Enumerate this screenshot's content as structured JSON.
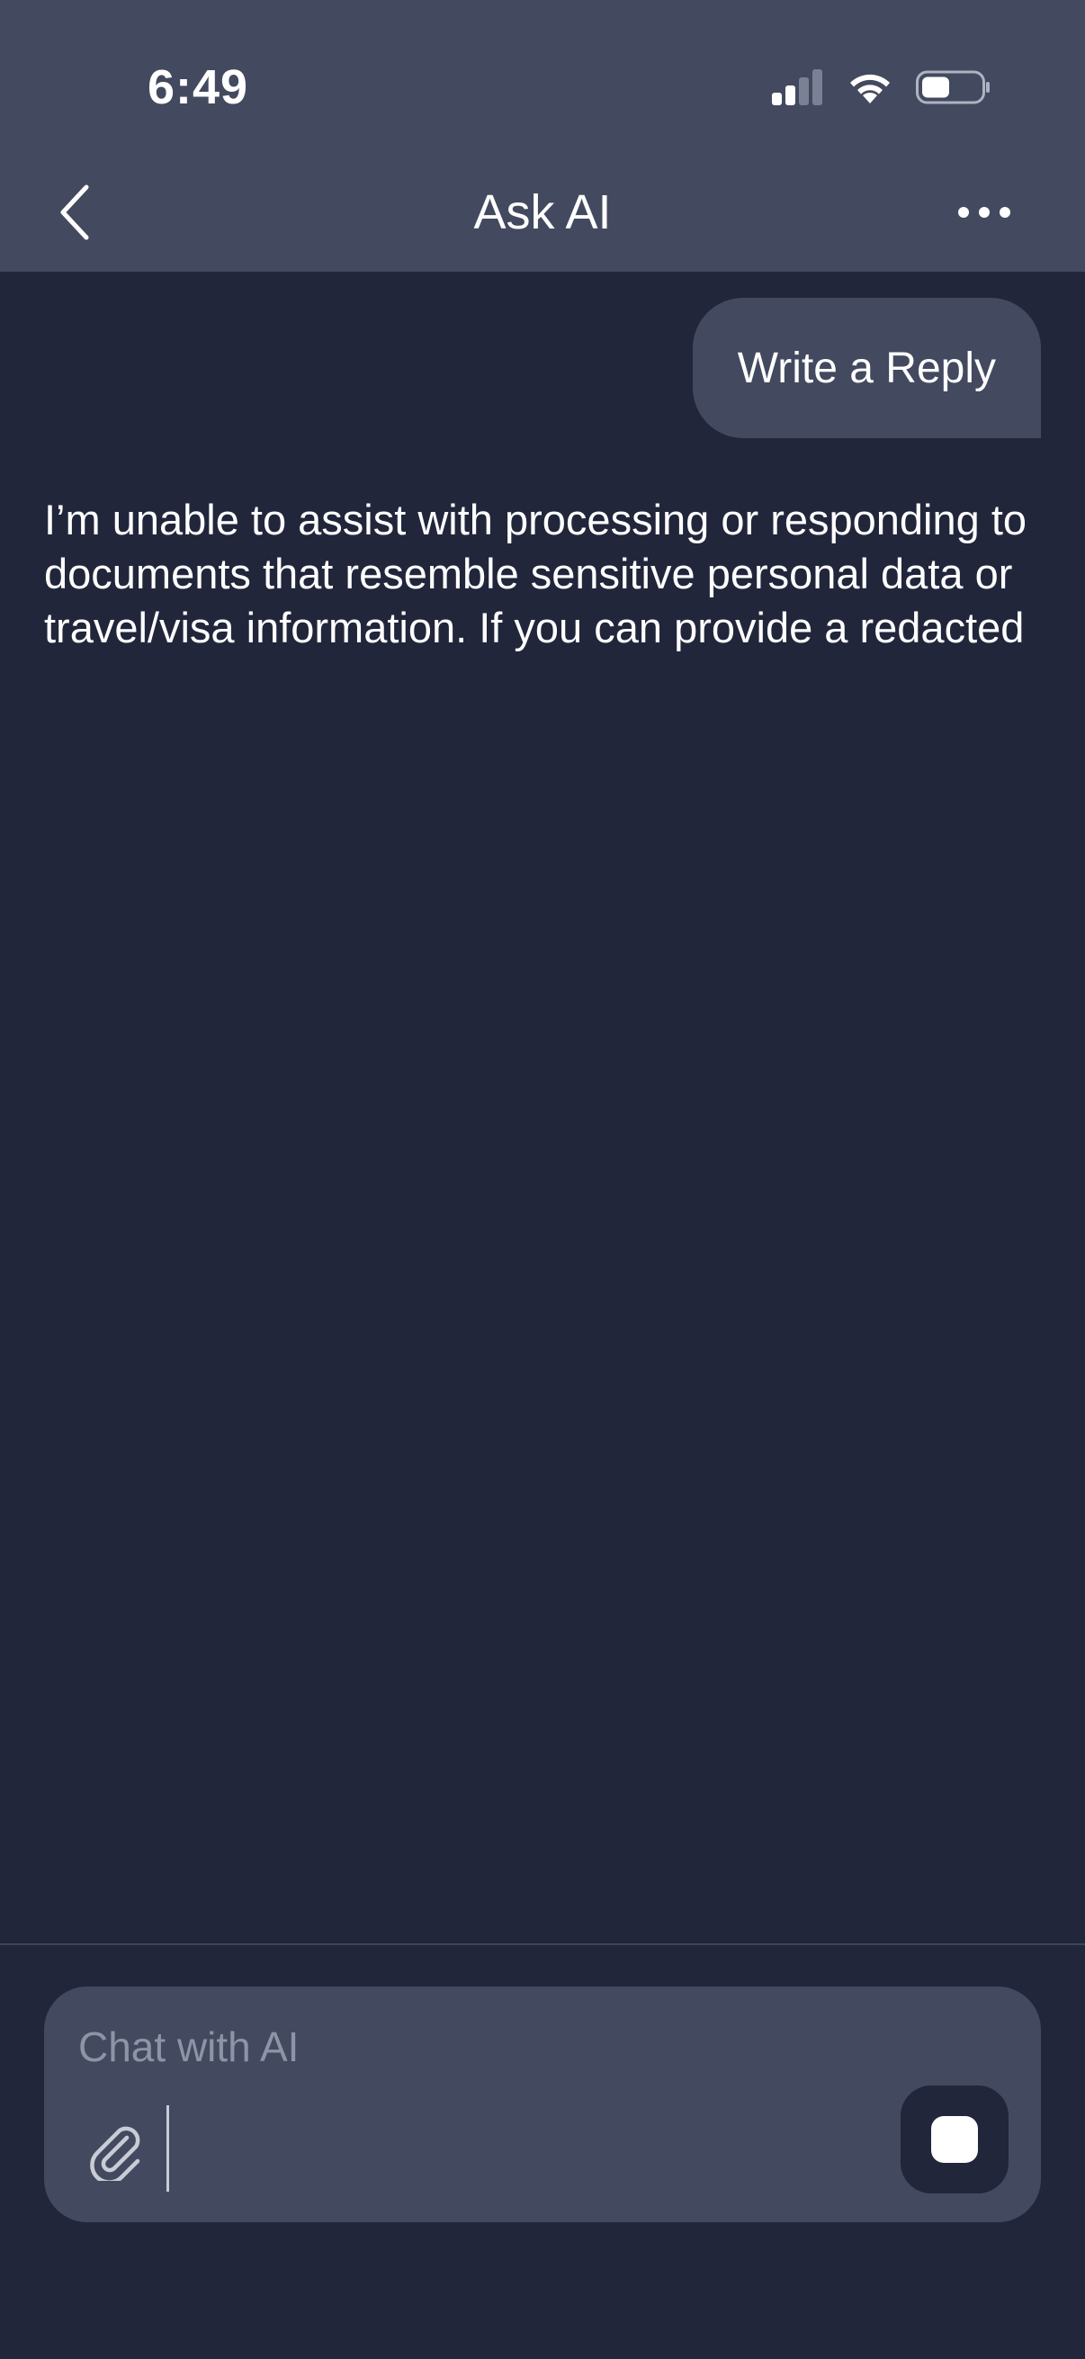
{
  "status_bar": {
    "time": "6:49",
    "icons": [
      "signal-icon",
      "wifi-icon",
      "battery-icon"
    ]
  },
  "nav": {
    "title": "Ask AI",
    "back_icon": "chevron-left-icon",
    "more_icon": "ellipsis-icon"
  },
  "messages": [
    {
      "role": "user",
      "text": "Write a Reply"
    },
    {
      "role": "assistant",
      "text": "I’m unable to assist with processing or responding to documents that resemble sensitive personal data or travel/visa information. If you can provide a redacted"
    }
  ],
  "composer": {
    "placeholder": "Chat with AI",
    "value": "",
    "attach_icon": "paperclip-icon",
    "stop_icon": "stop-icon"
  },
  "colors": {
    "background": "#21263b",
    "surface": "#434a5f",
    "text": "#ffffff",
    "placeholder": "#8e94a6"
  }
}
